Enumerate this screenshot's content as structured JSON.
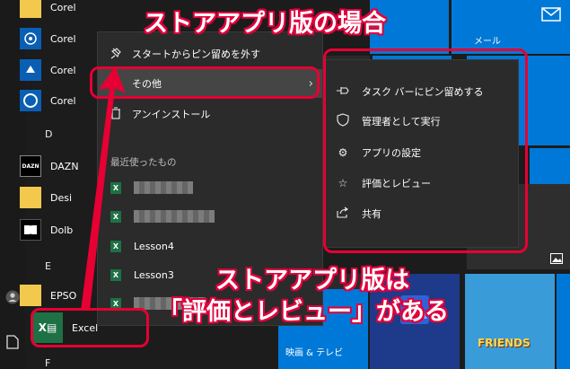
{
  "callouts": {
    "top": "ストアアプリ版の場合",
    "bottom_line1": "ストアアプリ版は",
    "bottom_line2": "「評価とレビュー」がある"
  },
  "app_list": {
    "items": [
      {
        "label": "Corel"
      },
      {
        "label": "Corel"
      },
      {
        "label": "Corel"
      },
      {
        "label": "Corel"
      },
      {
        "label": "DAZN",
        "tile_text": "DAZN"
      },
      {
        "label": "Desi"
      },
      {
        "label": "Dolb"
      },
      {
        "label": "EPSO"
      },
      {
        "label": "Excel"
      }
    ],
    "section_d": "D",
    "section_e": "E",
    "section_f": "F"
  },
  "context_menu": {
    "unpin": "スタートからピン留めを外す",
    "more": "その他",
    "uninstall": "アンインストール",
    "recent_header": "最近使ったもの",
    "recent": [
      "Lesson4",
      "Lesson3"
    ]
  },
  "submenu": {
    "items": [
      {
        "label": "タスク バーにピン留めする",
        "icon": "pin-icon"
      },
      {
        "label": "管理者として実行",
        "icon": "shield-icon"
      },
      {
        "label": "アプリの設定",
        "icon": "gear-icon"
      },
      {
        "label": "評価とレビュー",
        "icon": "star-icon"
      },
      {
        "label": "共有",
        "icon": "share-icon"
      }
    ]
  },
  "tiles": {
    "mail": "メール",
    "movies": "映画 & テレビ",
    "friends": "FRIENDS"
  },
  "colors": {
    "accent": "#0078d7",
    "highlight": "#e60033",
    "excel": "#1e7145"
  }
}
